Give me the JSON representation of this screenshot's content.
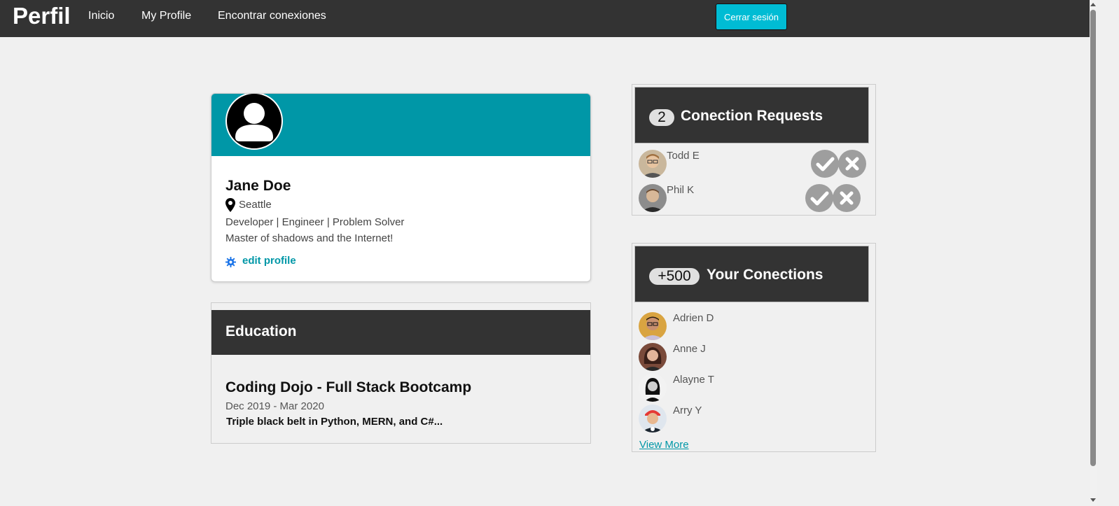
{
  "nav": {
    "brand": "Perfil",
    "links": [
      "Inicio",
      "My Profile",
      "Encontrar conexiones"
    ],
    "logout_label": "Cerrar sesión"
  },
  "profile": {
    "name": "Jane Doe",
    "location": "Seattle",
    "headline": "Developer | Engineer | Problem Solver",
    "bio": "Master of shadows and the Internet!",
    "edit_label": "edit profile"
  },
  "education": {
    "title": "Education",
    "school": "Coding Dojo - Full Stack Bootcamp",
    "dates": "Dec 2019 - Mar 2020",
    "description": "Triple black belt in Python, MERN, and C#..."
  },
  "requests": {
    "count": "2",
    "title": "Conection Requests",
    "people": [
      {
        "name": "Todd E"
      },
      {
        "name": "Phil K"
      }
    ]
  },
  "connections": {
    "count": "+500",
    "title": "Your Conections",
    "people": [
      {
        "name": "Adrien D"
      },
      {
        "name": "Anne J"
      },
      {
        "name": "Alayne T"
      },
      {
        "name": "Arry Y"
      }
    ],
    "view_more": "View More"
  },
  "colors": {
    "nav_bg": "#333333",
    "accent": "#0097a7",
    "logout_bg": "#00bcd4",
    "action_gray": "#9e9e9e"
  }
}
